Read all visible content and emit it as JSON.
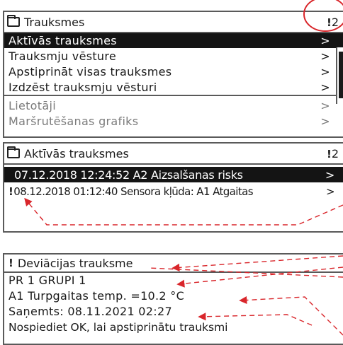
{
  "menu": {
    "title": "Trauksmes",
    "alarm_count": "2",
    "items": [
      {
        "label": "Aktīvās trauksmes",
        "arrow": ">"
      },
      {
        "label": "Trauksmju vēsture",
        "arrow": ">"
      },
      {
        "label": "Apstiprināt visas trauksmes",
        "arrow": ">"
      },
      {
        "label": "Izdzēst trauksmju vēsturi",
        "arrow": ">"
      },
      {
        "label": "Lietotāji",
        "arrow": ">"
      },
      {
        "label": "Maršrutēšanas grafiks",
        "arrow": ">"
      }
    ]
  },
  "active": {
    "title": "Aktīvās trauksmes",
    "alarm_count": "2",
    "rows": [
      {
        "text": "07.12.2018 12:24:52 A2 Aizsalšanas risks",
        "arrow": ">"
      },
      {
        "text": "08.12.2018 01:12:40 Sensora kļūda: A1 Atgaitas",
        "arrow": ">"
      }
    ]
  },
  "detail": {
    "title": "Deviācijas trauksme",
    "lines": [
      "PR 1  GRUPI 1",
      "A1 Turpgaitas temp.  =10.2 °C",
      "Saņemts: 08.11.2021 02:27",
      "Nospiediet OK, lai apstiprinātu trauksmi"
    ]
  },
  "colors": {
    "selection": "#141414",
    "annotation": "#d9262b",
    "border": "#5a5a5a",
    "dimmed_text": "#7b7b7b"
  }
}
